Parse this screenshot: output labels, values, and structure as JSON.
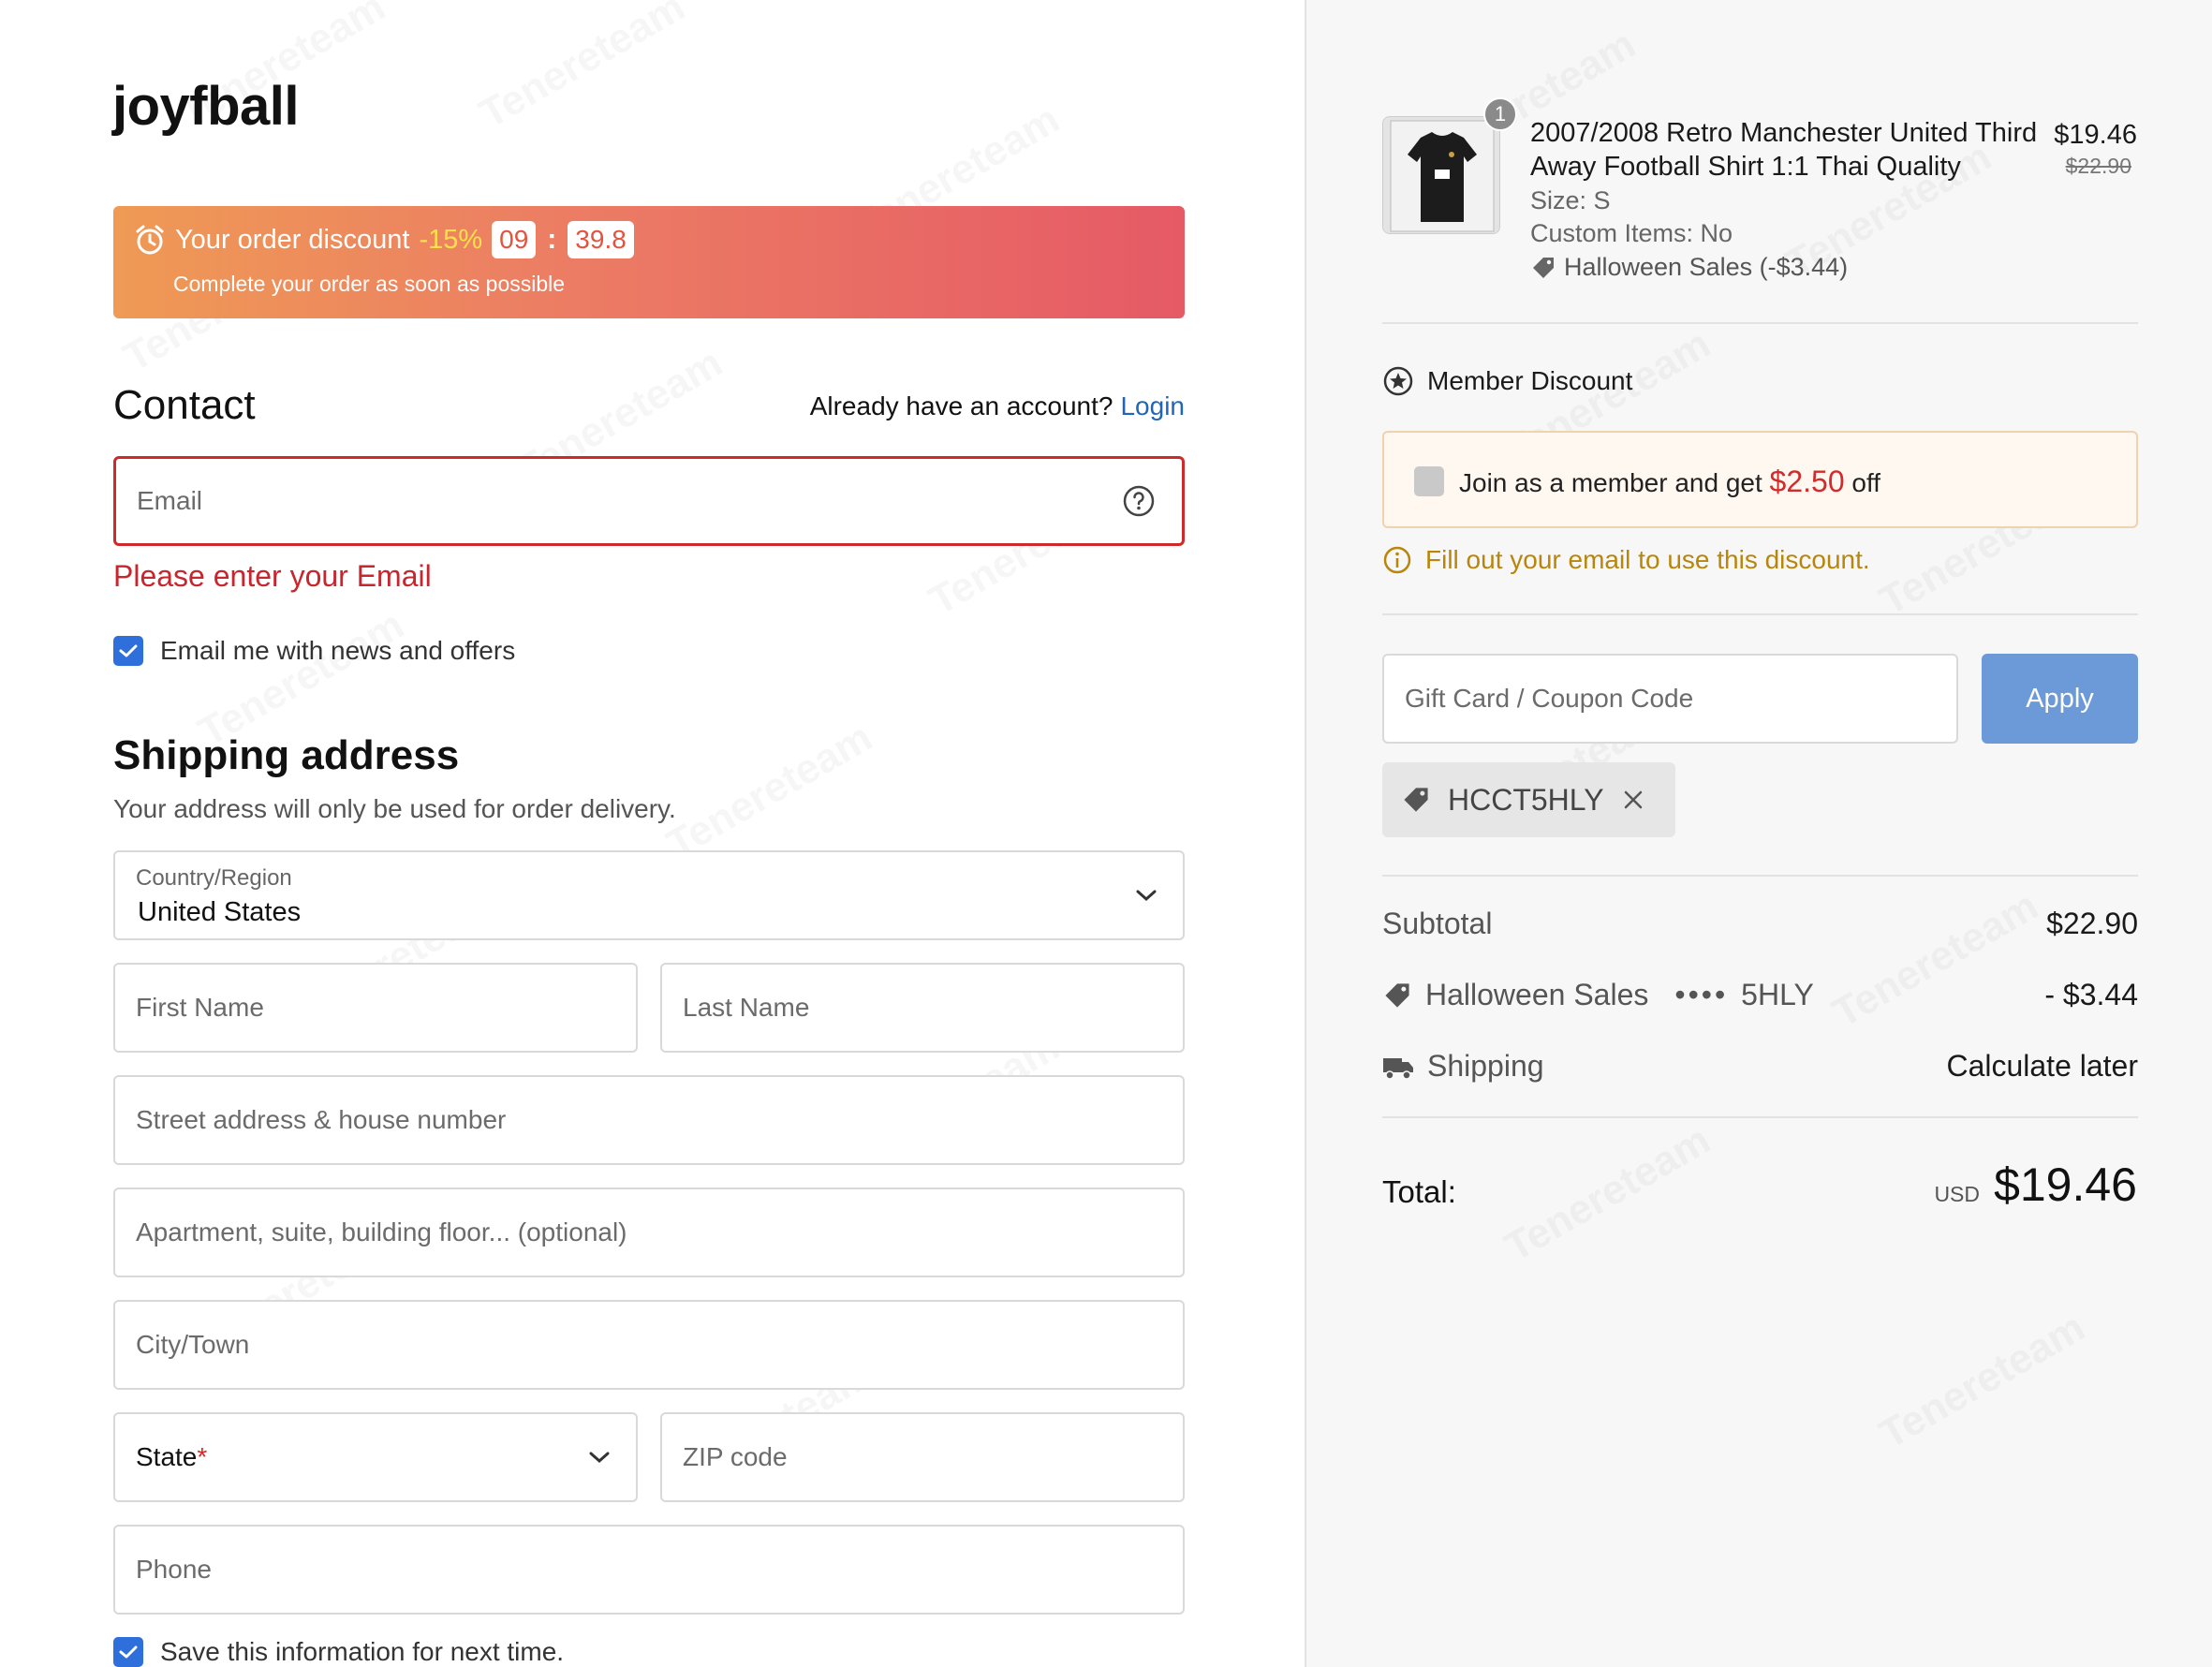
{
  "brand": {
    "logo": "joyfball"
  },
  "promo": {
    "label": "Your order discount",
    "percent": "-15%",
    "minutes": "09",
    "seconds": "39.8",
    "subtext": "Complete your order as soon as possible"
  },
  "contact": {
    "heading": "Contact",
    "account_prompt": "Already have an account?",
    "login_label": "Login",
    "email_placeholder": "Email",
    "email_error": "Please enter your Email",
    "news_label": "Email me with news and offers"
  },
  "shipping": {
    "heading": "Shipping address",
    "subtitle": "Your address will only be used for order delivery.",
    "country_label": "Country/Region",
    "country_value": "United States",
    "first_name": "First Name",
    "last_name": "Last Name",
    "street": "Street address & house number",
    "apartment": "Apartment, suite, building floor... (optional)",
    "city": "City/Town",
    "state": "State",
    "state_required": "*",
    "zip": "ZIP code",
    "phone": "Phone",
    "save_label": "Save this information for next time."
  },
  "cart": {
    "item": {
      "quantity": "1",
      "name": "2007/2008 Retro Manchester United Third Away Football Shirt 1:1 Thai Quality",
      "size": "Size: S",
      "custom": "Custom Items: No",
      "promo": "Halloween Sales (-$3.44)",
      "price": "$19.46",
      "original_price": "$22.90"
    },
    "member": {
      "heading": "Member Discount",
      "join_prefix": "Join as a member and get",
      "join_amount": "$2.50",
      "join_suffix": "off",
      "note": "Fill out your email to use this discount."
    },
    "gift_placeholder": "Gift Card / Coupon Code",
    "apply_label": "Apply",
    "coupon_code": "HCCT5HLY",
    "summary": {
      "subtotal_label": "Subtotal",
      "subtotal_value": "$22.90",
      "discount_label": "Halloween Sales",
      "discount_dots": "••••",
      "discount_code": "5HLY",
      "discount_value": "- $3.44",
      "shipping_label": "Shipping",
      "shipping_value": "Calculate later",
      "total_label": "Total:",
      "currency": "USD",
      "total_value": "$19.46"
    }
  },
  "colors": {
    "accent": "#2e6fdb",
    "error": "#cf2a2a",
    "apply_button": "#6c9ad9",
    "promo_start": "#ef9a55",
    "promo_end": "#e65a66"
  }
}
